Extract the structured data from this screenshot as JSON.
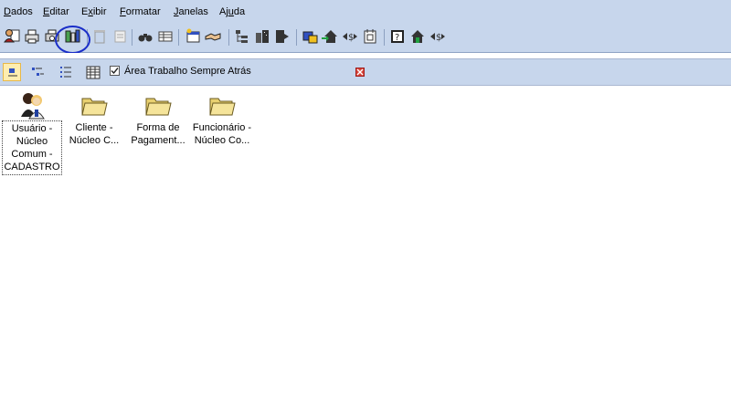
{
  "menu": [
    {
      "label": "Dados",
      "key": "D"
    },
    {
      "label": "Editar",
      "key": "E"
    },
    {
      "label": "Exibir",
      "key": "x"
    },
    {
      "label": "Formatar",
      "key": "F"
    },
    {
      "label": "Janelas",
      "key": "J"
    },
    {
      "label": "Ajuda",
      "key": "u"
    }
  ],
  "viewbar": {
    "checkbox_label": "Área Trabalho Sempre Atrás",
    "checkbox_checked": true
  },
  "desktop_items": [
    {
      "label": "Usuário - Núcleo Comum - CADASTRO",
      "icon": "users-icon",
      "selected": true
    },
    {
      "label": "Cliente - Núcleo C...",
      "icon": "folder-icon",
      "selected": false
    },
    {
      "label": "Forma de Pagament...",
      "icon": "folder-icon",
      "selected": false
    },
    {
      "label": "Funcionário - Núcleo Co...",
      "icon": "folder-icon",
      "selected": false
    }
  ],
  "colors": {
    "bar": "#c7d6ec",
    "annotation": "#1a2ec8",
    "close": "#d8453a"
  }
}
